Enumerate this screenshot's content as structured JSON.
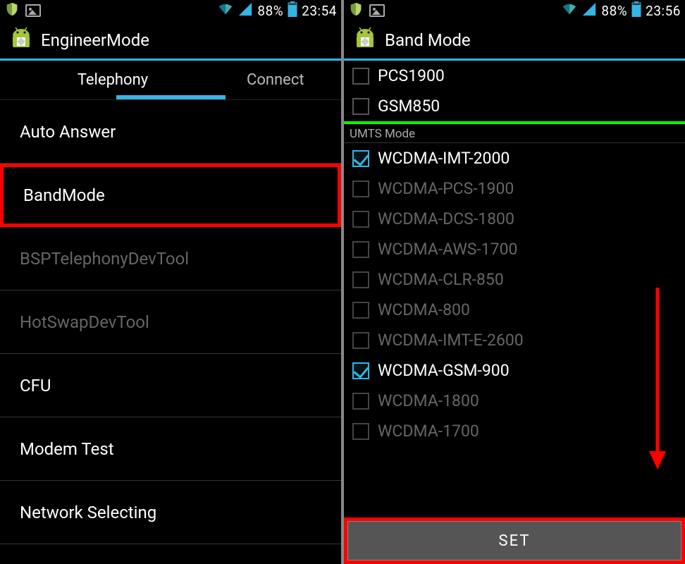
{
  "left": {
    "statusbar": {
      "battery": "88%",
      "time": "23:54"
    },
    "title": "EngineerMode",
    "tabs": {
      "active": "Telephony",
      "next": "Connect"
    },
    "items": [
      {
        "label": "Auto Answer",
        "disabled": false,
        "highlight": false
      },
      {
        "label": "BandMode",
        "disabled": false,
        "highlight": true
      },
      {
        "label": "BSPTelephonyDevTool",
        "disabled": true,
        "highlight": false
      },
      {
        "label": "HotSwapDevTool",
        "disabled": true,
        "highlight": false
      },
      {
        "label": "CFU",
        "disabled": false,
        "highlight": false
      },
      {
        "label": "Modem Test",
        "disabled": false,
        "highlight": false
      },
      {
        "label": "Network Selecting",
        "disabled": false,
        "highlight": false
      }
    ]
  },
  "right": {
    "statusbar": {
      "battery": "88%",
      "time": "23:56"
    },
    "title": "Band Mode",
    "gsm_items": [
      {
        "label": "PCS1900",
        "checked": false,
        "disabled": false
      },
      {
        "label": "GSM850",
        "checked": false,
        "disabled": false
      }
    ],
    "umts_header": "UMTS Mode",
    "umts_items": [
      {
        "label": "WCDMA-IMT-2000",
        "checked": true,
        "disabled": false
      },
      {
        "label": "WCDMA-PCS-1900",
        "checked": false,
        "disabled": true
      },
      {
        "label": "WCDMA-DCS-1800",
        "checked": false,
        "disabled": true
      },
      {
        "label": "WCDMA-AWS-1700",
        "checked": false,
        "disabled": true
      },
      {
        "label": "WCDMA-CLR-850",
        "checked": false,
        "disabled": true
      },
      {
        "label": "WCDMA-800",
        "checked": false,
        "disabled": true
      },
      {
        "label": "WCDMA-IMT-E-2600",
        "checked": false,
        "disabled": true
      },
      {
        "label": "WCDMA-GSM-900",
        "checked": true,
        "disabled": false
      },
      {
        "label": "WCDMA-1800",
        "checked": false,
        "disabled": true
      },
      {
        "label": "WCDMA-1700",
        "checked": false,
        "disabled": true
      }
    ],
    "set_button": "SET"
  },
  "colors": {
    "holo_blue": "#33b5e5",
    "highlight": "#ff0000",
    "divider_green": "#00ff00"
  }
}
